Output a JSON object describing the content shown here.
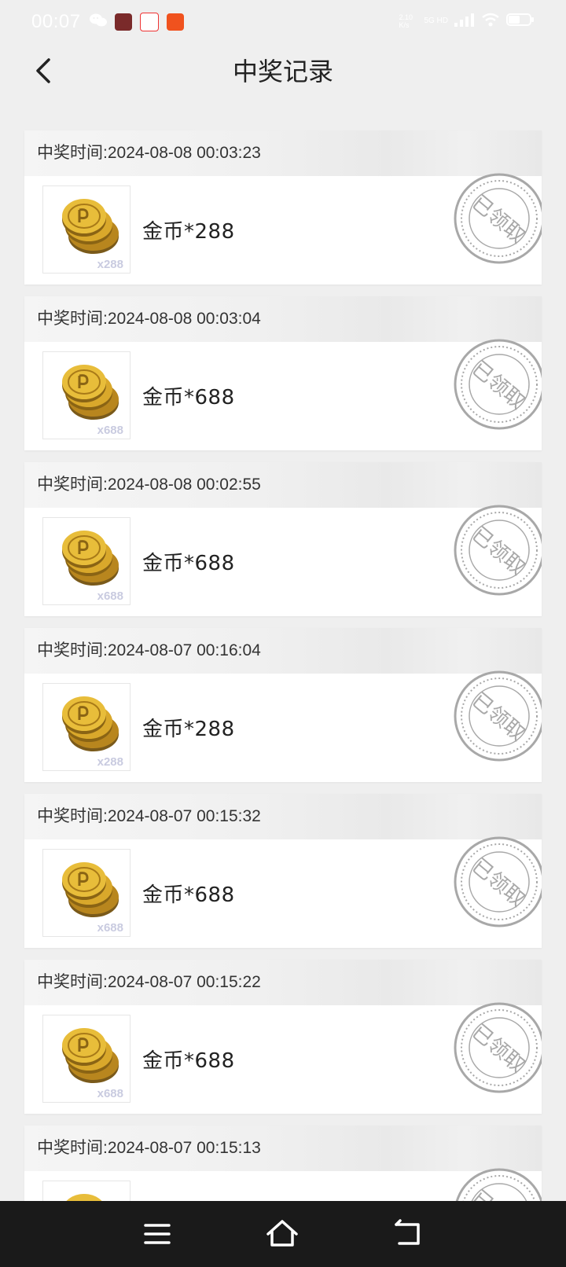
{
  "status_bar": {
    "time": "00:07",
    "right_text": "2.10 K/s",
    "network": "5G HD"
  },
  "header": {
    "title": "中奖记录"
  },
  "records": [
    {
      "time_label": "中奖时间:2024-08-08 00:03:23",
      "prize_name": "金币*288",
      "qty": "x288",
      "stamp": "已领取"
    },
    {
      "time_label": "中奖时间:2024-08-08 00:03:04",
      "prize_name": "金币*688",
      "qty": "x688",
      "stamp": "已领取"
    },
    {
      "time_label": "中奖时间:2024-08-08 00:02:55",
      "prize_name": "金币*688",
      "qty": "x688",
      "stamp": "已领取"
    },
    {
      "time_label": "中奖时间:2024-08-07 00:16:04",
      "prize_name": "金币*288",
      "qty": "x288",
      "stamp": "已领取"
    },
    {
      "time_label": "中奖时间:2024-08-07 00:15:32",
      "prize_name": "金币*688",
      "qty": "x688",
      "stamp": "已领取"
    },
    {
      "time_label": "中奖时间:2024-08-07 00:15:22",
      "prize_name": "金币*688",
      "qty": "x688",
      "stamp": "已领取"
    },
    {
      "time_label": "中奖时间:2024-08-07 00:15:13",
      "prize_name": "",
      "qty": "",
      "stamp": "已领取"
    }
  ],
  "icons": {
    "back": "chevron-left-icon",
    "menu": "menu-icon",
    "home": "home-icon",
    "return": "return-icon",
    "prize": "gold-coins-icon",
    "stamp": "claimed-stamp-icon"
  },
  "colors": {
    "background": "#efefef",
    "card": "#ffffff",
    "stamp": "#a8a8a8",
    "qty": "#c9cbe0",
    "nav_bar": "#1a1a1a"
  }
}
